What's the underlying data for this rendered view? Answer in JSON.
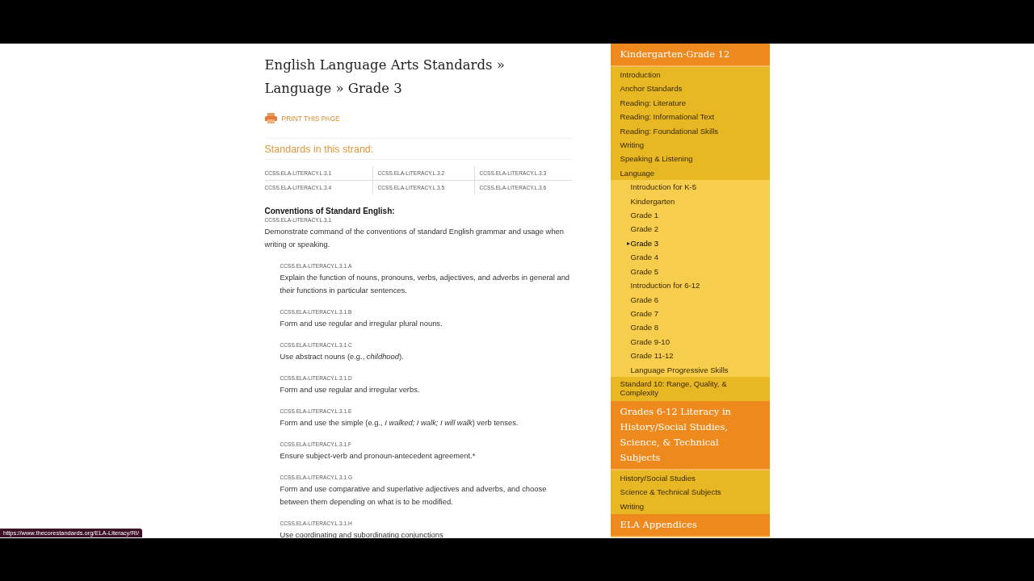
{
  "title": "English Language Arts Standards » Language » Grade 3",
  "print_link": "PRINT THIS PAGE",
  "strand_heading": "Standards in this strand:",
  "strand_codes": [
    "CCSS.ELA-LITERACY.L.3.1",
    "CCSS.ELA-LITERACY.L.3.2",
    "CCSS.ELA-LITERACY.L.3.3",
    "CCSS.ELA-LITERACY.L.3.4",
    "CCSS.ELA-LITERACY.L.3.5",
    "CCSS.ELA-LITERACY.L.3.6"
  ],
  "section_heading": "Conventions of Standard English:",
  "standards": [
    {
      "kind": "main",
      "code": "CCSS.ELA-LITERACY.L.3.1",
      "text": "Demonstrate command of the conventions of standard English grammar and usage when writing or speaking."
    },
    {
      "kind": "sub",
      "code": "CCSS.ELA-LITERACY.L.3.1.A",
      "text": "Explain the function of nouns, pronouns, verbs, adjectives, and adverbs in general and their functions in particular sentences."
    },
    {
      "kind": "sub",
      "code": "CCSS.ELA-LITERACY.L.3.1.B",
      "text": "Form and use regular and irregular plural nouns."
    },
    {
      "kind": "sub",
      "code": "CCSS.ELA-LITERACY.L.3.1.C",
      "text": "Use abstract nouns (e.g., *childhood*)."
    },
    {
      "kind": "sub",
      "code": "CCSS.ELA-LITERACY.L.3.1.D",
      "text": "Form and use regular and irregular verbs."
    },
    {
      "kind": "sub",
      "code": "CCSS.ELA-LITERACY.L.3.1.E",
      "text": "Form and use the simple (e.g., *I walked; I walk; I will walk*) verb tenses."
    },
    {
      "kind": "sub",
      "code": "CCSS.ELA-LITERACY.L.3.1.F",
      "text": "Ensure subject-verb and pronoun-antecedent agreement.*"
    },
    {
      "kind": "sub",
      "code": "CCSS.ELA-LITERACY.L.3.1.G",
      "text": "Form and use comparative and superlative adjectives and adverbs, and choose between them depending on what is to be modified."
    },
    {
      "kind": "sub",
      "code": "CCSS.ELA-LITERACY.L.3.1.H",
      "text": "Use coordinating and subordinating conjunctions"
    }
  ],
  "nav": [
    {
      "heading": "Kindergarten-Grade 12",
      "items": [
        {
          "label": "Introduction"
        },
        {
          "label": "Anchor Standards"
        },
        {
          "label": "Reading: Literature"
        },
        {
          "label": "Reading: Informational Text"
        },
        {
          "label": "Reading: Foundational Skills"
        },
        {
          "label": "Writing"
        },
        {
          "label": "Speaking & Listening"
        },
        {
          "label": "Language",
          "children": [
            {
              "label": "Introduction for K-5",
              "selected": false
            },
            {
              "label": "Kindergarten",
              "selected": false
            },
            {
              "label": "Grade 1",
              "selected": false
            },
            {
              "label": "Grade 2",
              "selected": false
            },
            {
              "label": "Grade 3",
              "selected": true
            },
            {
              "label": "Grade 4",
              "selected": false
            },
            {
              "label": "Grade 5",
              "selected": false
            },
            {
              "label": "Introduction for 6-12",
              "selected": false
            },
            {
              "label": "Grade 6",
              "selected": false
            },
            {
              "label": "Grade 7",
              "selected": false
            },
            {
              "label": "Grade 8",
              "selected": false
            },
            {
              "label": "Grade 9-10",
              "selected": false
            },
            {
              "label": "Grade 11-12",
              "selected": false
            },
            {
              "label": "Language Progressive Skills",
              "selected": false
            }
          ]
        },
        {
          "label": "Standard 10: Range, Quality, & Complexity"
        }
      ]
    },
    {
      "heading": "Grades 6-12 Literacy in History/Social Studies, Science, & Technical Subjects",
      "items": [
        {
          "label": "History/Social Studies"
        },
        {
          "label": "Science & Technical Subjects"
        },
        {
          "label": "Writing"
        }
      ]
    },
    {
      "heading": "ELA Appendices"
    }
  ],
  "status_url": "https://www.thecorestandards.org/ELA-Literacy/RI/"
}
